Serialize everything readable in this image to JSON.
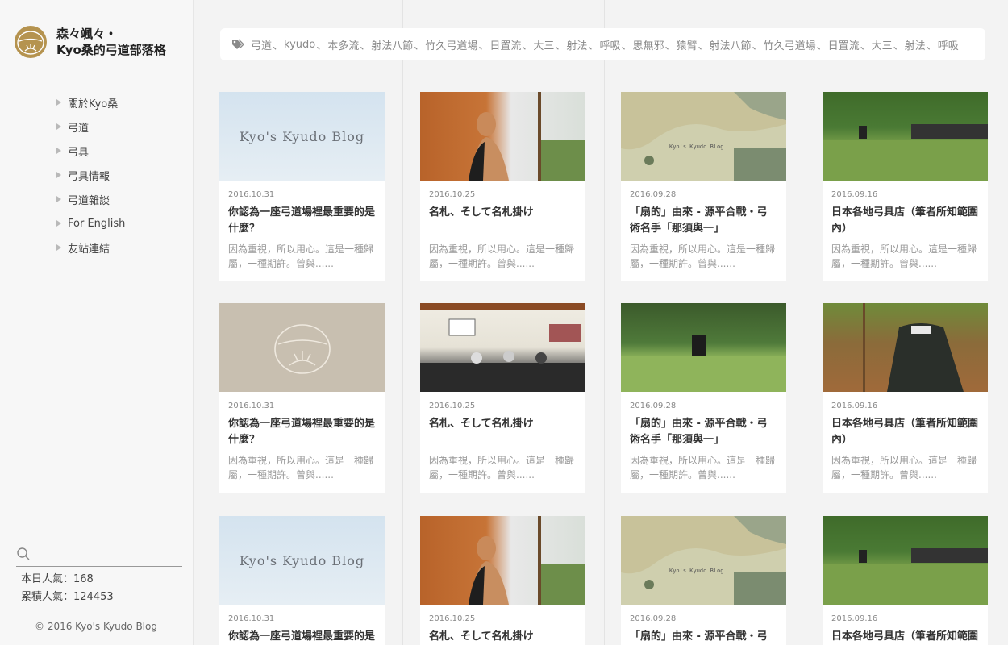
{
  "brand": {
    "line1": "森々颯々・",
    "line2": "Kyo桑的弓道部落格"
  },
  "nav": [
    "關於Kyo桑",
    "弓道",
    "弓具",
    "弓具情報",
    "弓道雜談",
    "For English",
    "友站連結"
  ],
  "search": {
    "placeholder": ""
  },
  "stats": {
    "today": "本日人氣：168",
    "total": "累積人氣：124453"
  },
  "copyright": "© 2016 Kyo's Kyudo Blog",
  "tags": [
    "弓道",
    "kyudo",
    "本多流",
    "射法八節",
    "竹久弓道場",
    "日置流",
    "大三",
    "射法",
    "呼吸",
    "思無邪",
    "猿臂",
    "射法八節",
    "竹久弓道場",
    "日置流",
    "大三",
    "射法",
    "呼吸"
  ],
  "thumb_text": "Kyo's Kyudo Blog",
  "posts": [
    {
      "date": "2016.10.31",
      "title": "你認為一座弓道場裡最重要的是什麼？",
      "excerpt": "因為重視，所以用心。這是一種歸屬，一種期許。曾與......"
    },
    {
      "date": "2016.10.25",
      "title": "名札、そして名札掛け",
      "excerpt": "因為重視，所以用心。這是一種歸屬，一種期許。曾與......"
    },
    {
      "date": "2016.09.28",
      "title": "「扇的」由來 - 源平合戰・弓術名手「那須與一」",
      "excerpt": "因為重視，所以用心。這是一種歸屬，一種期許。曾與......"
    },
    {
      "date": "2016.09.16",
      "title": "日本各地弓具店（筆者所知範圍內）",
      "excerpt": "因為重視，所以用心。這是一種歸屬，一種期許。曾與......"
    },
    {
      "date": "2016.10.31",
      "title": "你認為一座弓道場裡最重要的是什麼？",
      "excerpt": "因為重視，所以用心。這是一種歸屬，一種期許。曾與......"
    },
    {
      "date": "2016.10.25",
      "title": "名札、そして名札掛け",
      "excerpt": "因為重視，所以用心。這是一種歸屬，一種期許。曾與......"
    },
    {
      "date": "2016.09.28",
      "title": "「扇的」由來 - 源平合戰・弓術名手「那須與一」",
      "excerpt": "因為重視，所以用心。這是一種歸屬，一種期許。曾與......"
    },
    {
      "date": "2016.09.16",
      "title": "日本各地弓具店（筆者所知範圍內）",
      "excerpt": "因為重視，所以用心。這是一種歸屬，一種期許。曾與......"
    },
    {
      "date": "2016.10.31",
      "title": "你認為一座弓道場裡最重要的是什麼？",
      "excerpt": ""
    },
    {
      "date": "2016.10.25",
      "title": "名札、そして名札掛け",
      "excerpt": ""
    },
    {
      "date": "2016.09.28",
      "title": "「扇的」由來 - 源平合戰・弓術名手「那須與一」",
      "excerpt": ""
    },
    {
      "date": "2016.09.16",
      "title": "日本各地弓具店（筆者所知範圍內）",
      "excerpt": ""
    }
  ],
  "colors": {
    "accent": "#b5934f",
    "background": "#f3f3f3",
    "card": "#ffffff"
  }
}
